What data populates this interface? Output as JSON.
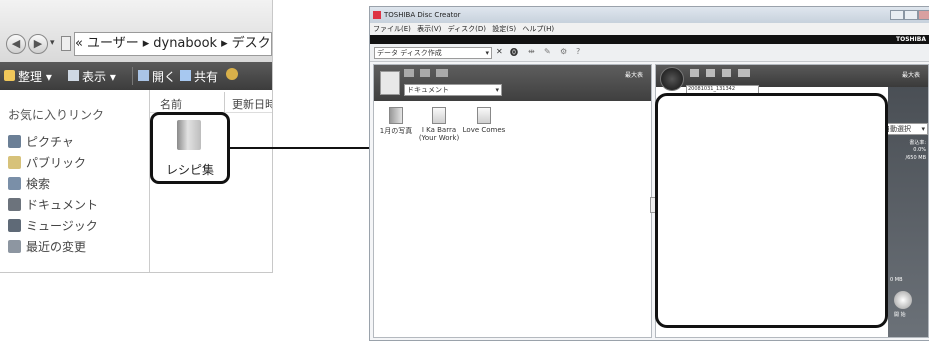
{
  "explorer": {
    "address_crumbs": [
      "«",
      "ユーザー",
      "▸",
      "dynabook",
      "▸",
      "デスク"
    ],
    "toolbar": {
      "organize": "整理 ▾",
      "view": "表示 ▾",
      "open": "開く",
      "share": "共有"
    },
    "sidebar_heading": "お気に入りリンク",
    "sidebar_items": [
      "ピクチャ",
      "パブリック",
      "検索",
      "ドキュメント",
      "ミュージック",
      "最近の変更"
    ],
    "columns": {
      "name": "名前",
      "modified": "更新日時"
    },
    "folder_label": "レシピ集"
  },
  "app": {
    "title": "TOSHIBA Disc Creator",
    "menu": [
      "ファイル(E)",
      "表示(V)",
      "ディスク(D)",
      "設定(S)",
      "ヘルプ(H)"
    ],
    "brand": "TOSHIBA",
    "mode_select": "データ ディスク作成",
    "folder_select": "ドキュメント",
    "left_pane_label": "最大表",
    "files": [
      {
        "name": "1月の写真",
        "sub": ""
      },
      {
        "name": "I Ka Barra",
        "sub": "(Your Work)"
      },
      {
        "name": "Love Comes",
        "sub": ""
      }
    ],
    "disc_label_field": "20081031_131342",
    "right_pane_label": "最大表",
    "auto_select": "自動選択",
    "capacity_label": "書込率:",
    "capacity_percent": "0.0%",
    "capacity_total": "/650 MB",
    "size_marker": "0 MB",
    "start_button": "開 始"
  },
  "colors": {
    "accent_dark": "#3c3c3c",
    "frame": "#111111"
  }
}
